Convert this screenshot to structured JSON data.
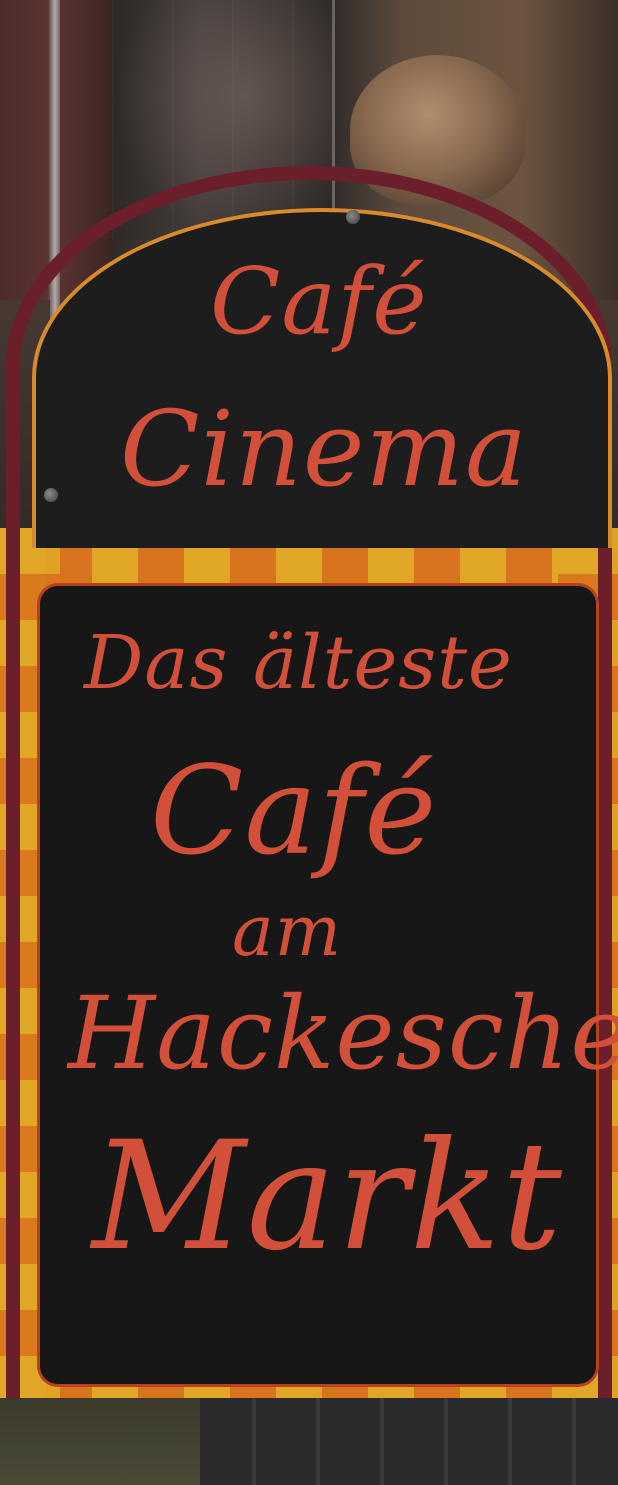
{
  "sign": {
    "header_line1": "Café",
    "header_line2": "Cinema",
    "board_line1": "Das älteste",
    "board_line2": "Café",
    "board_line3": "am",
    "board_line4": "Hackeschen",
    "board_line5": "Markt"
  },
  "colors": {
    "frame": "#6b1f2a",
    "lettering": "#d2503a",
    "chalkboard": "#161716",
    "checker_yellow": "#e0a626",
    "checker_orange": "#d9741e"
  }
}
